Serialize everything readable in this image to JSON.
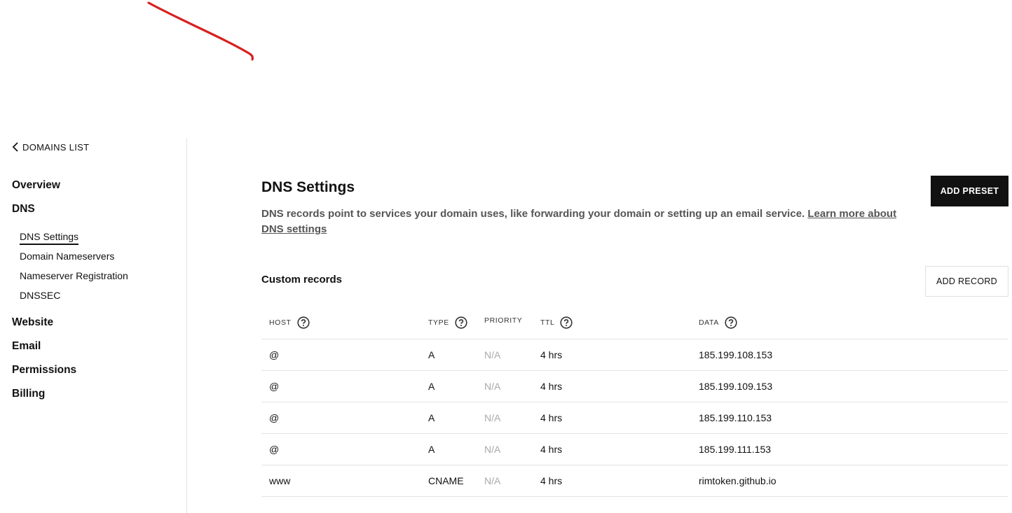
{
  "sidebar": {
    "back_label": "DOMAINS LIST",
    "nav": {
      "overview": "Overview",
      "dns": "DNS",
      "dns_settings": "DNS Settings",
      "domain_nameservers": "Domain Nameservers",
      "nameserver_registration": "Nameserver Registration",
      "dnssec": "DNSSEC",
      "website": "Website",
      "email": "Email",
      "permissions": "Permissions",
      "billing": "Billing"
    }
  },
  "main": {
    "title": "DNS Settings",
    "description": "DNS records point to services your domain uses, like forwarding your domain or setting up an email service.",
    "learn_more": "Learn more about DNS settings",
    "add_preset_label": "ADD PRESET",
    "custom_records_title": "Custom records",
    "add_record_label": "ADD RECORD"
  },
  "table": {
    "headers": {
      "host": "HOST",
      "type": "TYPE",
      "priority": "PRIORITY",
      "ttl": "TTL",
      "data": "DATA"
    },
    "rows": [
      {
        "host": "@",
        "type": "A",
        "priority": "N/A",
        "ttl": "4 hrs",
        "data": "185.199.108.153"
      },
      {
        "host": "@",
        "type": "A",
        "priority": "N/A",
        "ttl": "4 hrs",
        "data": "185.199.109.153"
      },
      {
        "host": "@",
        "type": "A",
        "priority": "N/A",
        "ttl": "4 hrs",
        "data": "185.199.110.153"
      },
      {
        "host": "@",
        "type": "A",
        "priority": "N/A",
        "ttl": "4 hrs",
        "data": "185.199.111.153"
      },
      {
        "host": "www",
        "type": "CNAME",
        "priority": "N/A",
        "ttl": "4 hrs",
        "data": "rimtoken.github.io"
      }
    ]
  },
  "icons": {
    "back": "chevron-left-icon",
    "help": "question-circle-icon"
  },
  "colors": {
    "annotation_stroke": "#d92020",
    "primary_button_bg": "#111111",
    "muted_text": "#aaaaaa",
    "description_text": "#555555"
  }
}
